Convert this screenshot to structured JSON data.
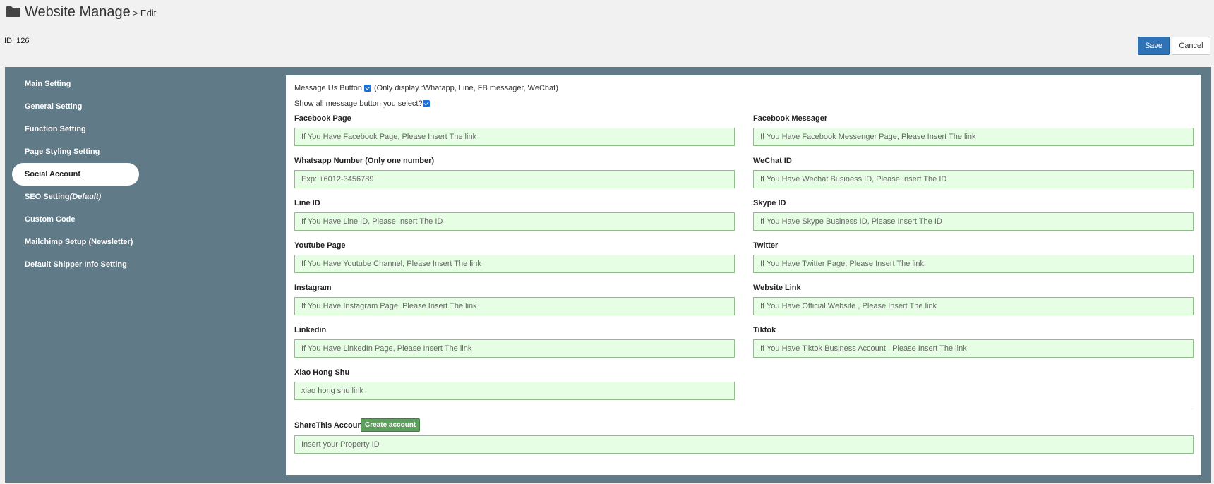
{
  "header": {
    "icon": "folder-icon",
    "title": "Website Manage",
    "subtitle": "> Edit",
    "id_text": "ID: 126"
  },
  "actions": {
    "save": "Save",
    "cancel": "Cancel"
  },
  "sidebar": {
    "items": [
      {
        "label": "Main Setting"
      },
      {
        "label": "General Setting"
      },
      {
        "label": "Function Setting"
      },
      {
        "label": "Page Styling Setting"
      },
      {
        "label": "Social Account",
        "active": true
      },
      {
        "label": "SEO Setting",
        "suffix": "(Default)"
      },
      {
        "label": "Custom Code"
      },
      {
        "label": "Mailchimp Setup (Newsletter)"
      },
      {
        "label": "Default Shipper Info Setting"
      }
    ]
  },
  "message_options": {
    "message_us_label": "Message Us Button",
    "message_us_checked": true,
    "message_us_note": "(Only display :Whatapp, Line, FB messager, WeChat)",
    "show_all_label": "Show all message button you select?",
    "show_all_checked": true
  },
  "fields": {
    "facebook_page": {
      "label": "Facebook Page",
      "placeholder": "If You Have Facebook Page, Please Insert The link"
    },
    "facebook_messager": {
      "label": "Facebook Messager",
      "placeholder": "If You Have Facebook Messenger Page, Please Insert The link"
    },
    "whatsapp": {
      "label": "Whatsapp Number (Only one number)",
      "placeholder": "Exp: +6012-3456789"
    },
    "wechat": {
      "label": "WeChat ID",
      "placeholder": "If You Have Wechat Business ID, Please Insert The ID"
    },
    "line": {
      "label": "Line ID",
      "placeholder": "If You Have Line ID, Please Insert The ID"
    },
    "skype": {
      "label": "Skype ID",
      "placeholder": "If You Have Skype Business ID, Please Insert The ID"
    },
    "youtube": {
      "label": "Youtube Page",
      "placeholder": "If You Have Youtube Channel, Please Insert The link"
    },
    "twitter": {
      "label": "Twitter",
      "placeholder": "If You Have Twitter Page, Please Insert The link"
    },
    "instagram": {
      "label": "Instagram",
      "placeholder": "If You Have Instagram Page, Please Insert The link"
    },
    "website": {
      "label": "Website Link",
      "placeholder": "If You Have Official Website , Please Insert The link"
    },
    "linkedin": {
      "label": "Linkedin",
      "placeholder": "If You Have LinkedIn Page, Please Insert The link"
    },
    "tiktok": {
      "label": "Tiktok",
      "placeholder": "If You Have Tiktok Business Account , Please Insert The link"
    },
    "xiaohongshu": {
      "label": "Xiao Hong Shu",
      "placeholder": "xiao hong shu link"
    },
    "sharethis": {
      "label": "ShareThis Account",
      "button": "Create account",
      "placeholder": "Insert your Property ID"
    }
  },
  "colors": {
    "panel_bg": "#607a87",
    "save_button": "#2f72b5",
    "field_bg": "#e6ffe4",
    "create_button": "#5d9f5d"
  }
}
